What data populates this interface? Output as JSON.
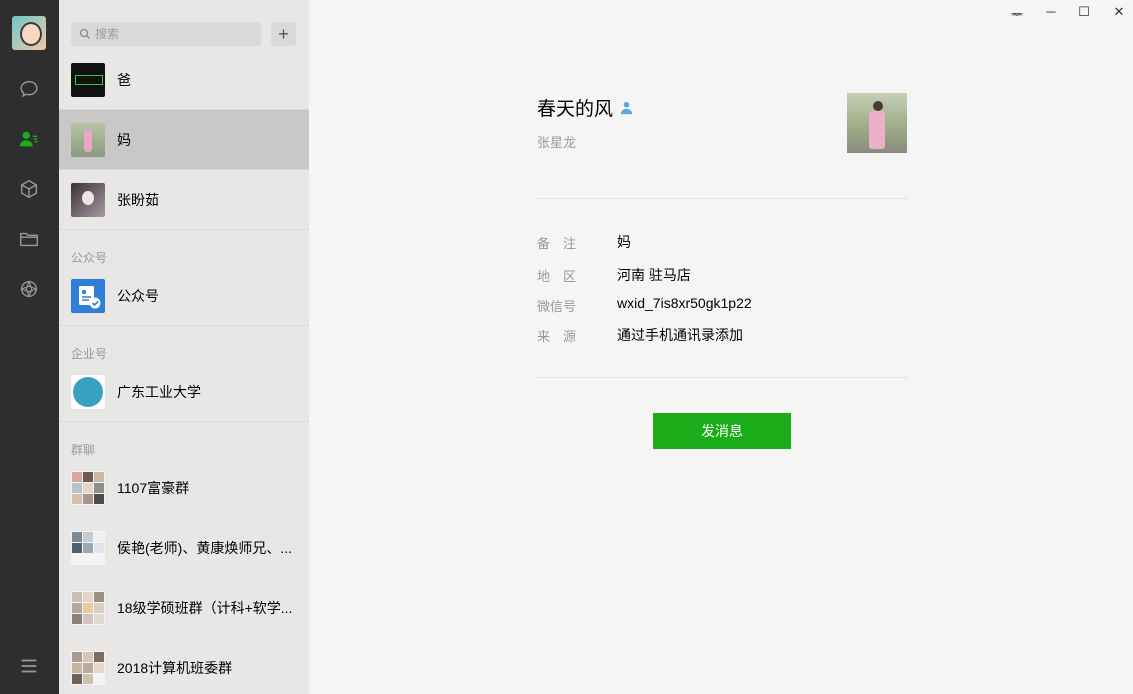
{
  "window_controls": {
    "pin": "ᆓ",
    "minimize": "─",
    "maximize": "☐",
    "close": "✕"
  },
  "rail": {
    "icons": [
      "user-avatar",
      "chat-icon",
      "contacts-icon",
      "cube-icon",
      "folder-icon",
      "moments-icon",
      "menu-icon"
    ]
  },
  "search": {
    "placeholder": "搜索",
    "add": "+"
  },
  "contacts": [
    {
      "name": "爸"
    },
    {
      "name": "妈"
    },
    {
      "name": "张盼茹"
    }
  ],
  "sections": {
    "official": "公众号",
    "enterprise": "企业号",
    "groups": "群聊"
  },
  "official": {
    "name": "公众号"
  },
  "enterprise": {
    "name": "广东工业大学"
  },
  "groups": [
    {
      "name": "1107富豪群"
    },
    {
      "name": "侯艳(老师)、黄康焕师兄、..."
    },
    {
      "name": "18级学硕班群（计科+软学..."
    },
    {
      "name": "2018计算机班委群"
    }
  ],
  "detail": {
    "nickname": "春天的风",
    "real_name": "张星龙",
    "fields": [
      {
        "label": "备　注",
        "value": "妈"
      },
      {
        "label": "地　区",
        "value": "河南  驻马店"
      },
      {
        "label": "微信号",
        "value": "wxid_7is8xr50gk1p22"
      },
      {
        "label": "来　源",
        "value": "通过手机通讯录添加"
      }
    ],
    "send_button": "发消息"
  },
  "colors": {
    "accent": "#1aad19",
    "rail": "#2e2e2e",
    "list": "#e8e7e6",
    "selected": "#c9c8c7"
  }
}
